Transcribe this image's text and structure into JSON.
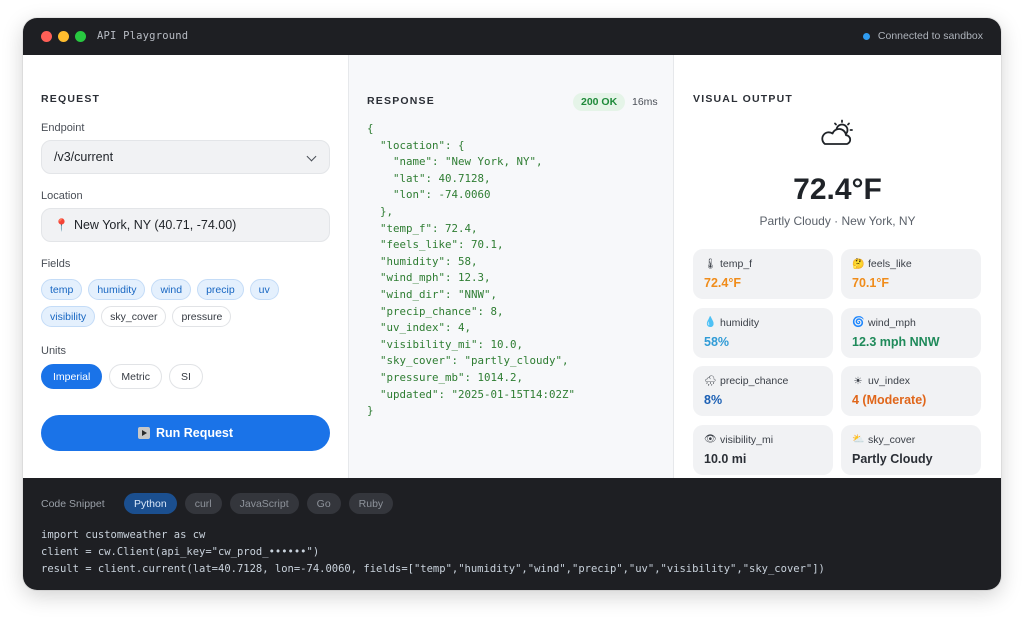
{
  "window": {
    "title": "API Playground",
    "connection": "Connected to sandbox"
  },
  "request": {
    "title": "REQUEST",
    "endpoint_label": "Endpoint",
    "endpoint_value": "/v3/current",
    "location_label": "Location",
    "location_value": "New York, NY (40.71, -74.00)",
    "fields_label": "Fields",
    "fields": [
      {
        "label": "temp",
        "selected": true
      },
      {
        "label": "humidity",
        "selected": true
      },
      {
        "label": "wind",
        "selected": true
      },
      {
        "label": "precip",
        "selected": true
      },
      {
        "label": "uv",
        "selected": true
      },
      {
        "label": "visibility",
        "selected": true
      },
      {
        "label": "sky_cover",
        "selected": false
      },
      {
        "label": "pressure",
        "selected": false
      }
    ],
    "units_label": "Units",
    "units": [
      {
        "label": "Imperial",
        "selected": true
      },
      {
        "label": "Metric",
        "selected": false
      },
      {
        "label": "SI",
        "selected": false
      }
    ],
    "run_label": "Run Request"
  },
  "response": {
    "title": "RESPONSE",
    "status": "200 OK",
    "latency": "16ms",
    "lines": [
      "{",
      "  \"location\": {",
      "    \"name\": \"New York, NY\",",
      "    \"lat\": 40.7128,",
      "    \"lon\": -74.0060",
      "  },",
      "  \"temp_f\": 72.4,",
      "  \"feels_like\": 70.1,",
      "  \"humidity\": 58,",
      "  \"wind_mph\": 12.3,",
      "  \"wind_dir\": \"NNW\",",
      "  \"precip_chance\": 8,",
      "  \"uv_index\": 4,",
      "  \"visibility_mi\": 10.0,",
      "  \"sky_cover\": \"partly_cloudy\",",
      "  \"pressure_mb\": 1014.2,",
      "  \"updated\": \"2025-01-15T14:02Z\"",
      "}"
    ]
  },
  "visual": {
    "title": "VISUAL OUTPUT",
    "icon": "partly-cloudy-icon",
    "temperature": "72.4°F",
    "condition": "Partly Cloudy · New York, NY",
    "metrics": [
      {
        "name": "temp-card",
        "icon": "thermometer-icon",
        "glyph": "🌡",
        "label": "temp_f",
        "value": "72.4°F",
        "color": "#f08c1a"
      },
      {
        "name": "feels-like-card",
        "icon": "thinking-face-icon",
        "glyph": "🤔",
        "label": "feels_like",
        "value": "70.1°F",
        "color": "#f08c1a"
      },
      {
        "name": "humidity-card",
        "icon": "droplet-icon",
        "glyph": "💧",
        "label": "humidity",
        "value": "58%",
        "color": "#2f9bd6"
      },
      {
        "name": "wind-card",
        "icon": "wind-icon",
        "glyph": "🌀",
        "label": "wind_mph",
        "value": "12.3 mph NNW",
        "color": "#1f8a5a"
      },
      {
        "name": "precip-card",
        "icon": "rain-cloud-icon",
        "glyph": "🌧",
        "label": "precip_chance",
        "value": "8%",
        "color": "#1a5fb4"
      },
      {
        "name": "uv-card",
        "icon": "sun-icon",
        "glyph": "☀",
        "label": "uv_index",
        "value": "4 (Moderate)",
        "color": "#e0661a"
      },
      {
        "name": "visibility-card",
        "icon": "eye-icon",
        "glyph": "👁",
        "label": "visibility_mi",
        "value": "10.0 mi",
        "color": "#2b2f36"
      },
      {
        "name": "sky-cover-card",
        "icon": "cloud-icon",
        "glyph": "⛅",
        "label": "sky_cover",
        "value": "Partly Cloudy",
        "color": "#2b2f36"
      }
    ]
  },
  "code": {
    "label": "Code Snippet",
    "tabs": [
      {
        "label": "Python",
        "selected": true
      },
      {
        "label": "curl",
        "selected": false
      },
      {
        "label": "JavaScript",
        "selected": false
      },
      {
        "label": "Go",
        "selected": false
      },
      {
        "label": "Ruby",
        "selected": false
      }
    ],
    "lines": [
      "import customweather as cw",
      "client = cw.Client(api_key=\"cw_prod_••••••\")",
      "result = client.current(lat=40.7128, lon=-74.0060, fields=[\"temp\",\"humidity\",\"wind\",\"precip\",\"uv\",\"visibility\",\"sky_cover\"])"
    ]
  }
}
